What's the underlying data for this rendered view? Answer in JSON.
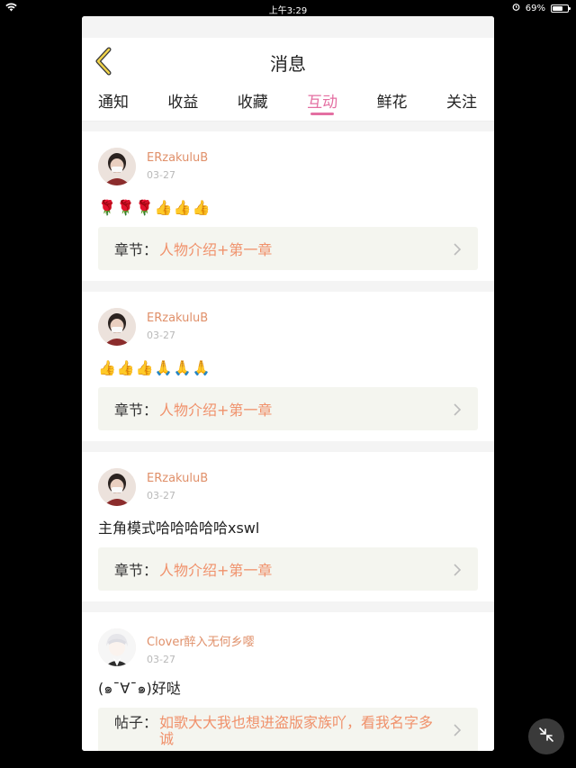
{
  "status_bar": {
    "time": "上午3:29",
    "battery": "69%",
    "battery_level": 0.69
  },
  "header": {
    "title": "消息",
    "back_icon": "back-chevron-icon"
  },
  "tabs": [
    {
      "label": "通知",
      "active": false
    },
    {
      "label": "收益",
      "active": false
    },
    {
      "label": "收藏",
      "active": false
    },
    {
      "label": "互动",
      "active": true
    },
    {
      "label": "鲜花",
      "active": false
    },
    {
      "label": "关注",
      "active": false
    }
  ],
  "messages": [
    {
      "username": "ERzakuluB",
      "date": "03-27",
      "content": "🌹🌹🌹👍👍👍",
      "ref_label": "章节：",
      "ref_value": "人物介绍+第一章"
    },
    {
      "username": "ERzakuluB",
      "date": "03-27",
      "content": "👍👍👍🙏🙏🙏",
      "ref_label": "章节：",
      "ref_value": "人物介绍+第一章"
    },
    {
      "username": "ERzakuluB",
      "date": "03-27",
      "content": "主角模式哈哈哈哈哈xswl",
      "ref_label": "章节：",
      "ref_value": "人物介绍+第一章"
    },
    {
      "username": "Clover醉入无何乡嘤",
      "date": "03-27",
      "content": "(๑¯∀¯๑)好哒",
      "ref_label": "帖子：",
      "ref_value": "如歌大大我也想进盗版家族吖，看我名字多诚"
    }
  ],
  "colors": {
    "accent": "#e46fa2",
    "username": "#e0906a",
    "reference": "#f0916b"
  }
}
